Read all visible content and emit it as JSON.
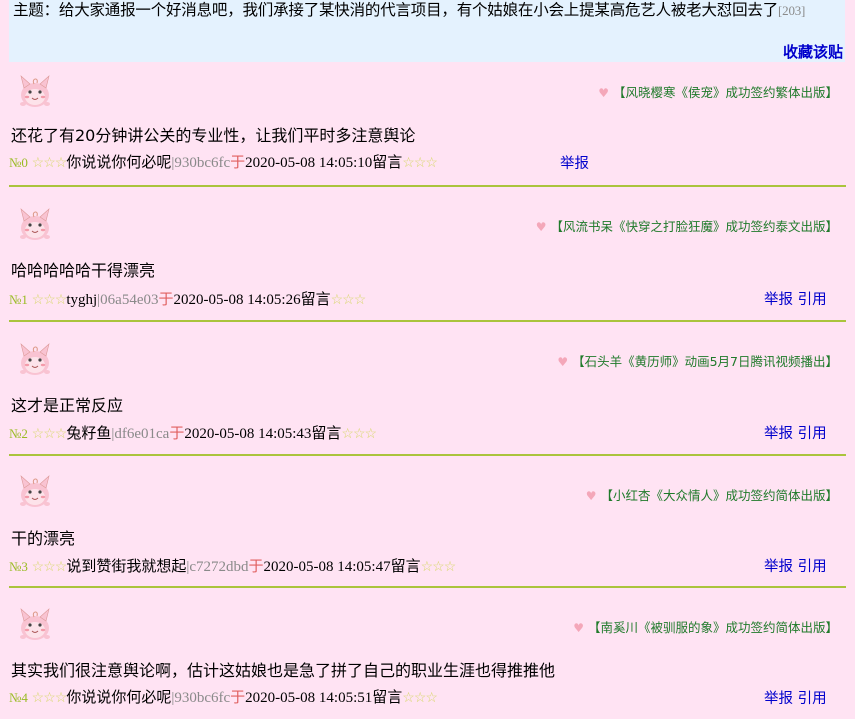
{
  "topic": {
    "text": "主题：给大家通报一个好消息吧，我们承接了某快消的代言项目，有个姑娘在小会上提某高危艺人被老大怼回去了",
    "count": "[203]",
    "favorite_label": "收藏该贴"
  },
  "posts": [
    {
      "ad": "【风晓樱寒《侯宠》成功签约繁体出版】",
      "content": "还花了有20分钟讲公关的专业性，让我们平时多注意舆论",
      "num": "№0",
      "stars_before": "☆☆☆",
      "author": "你说说你何必呢",
      "hash": "|930bc6fc",
      "yu": "于",
      "time": "2020-05-08 14:05:10",
      "liuyan": "留言",
      "stars_after": "☆☆☆",
      "report_label": "举报",
      "quote_label": ""
    },
    {
      "ad": "【风流书呆《快穿之打脸狂魔》成功签约泰文出版】",
      "content": "哈哈哈哈哈干得漂亮",
      "num": "№1",
      "stars_before": "☆☆☆",
      "author": "tyghj",
      "hash": "|06a54e03",
      "yu": "于",
      "time": "2020-05-08 14:05:26",
      "liuyan": "留言",
      "stars_after": "☆☆☆",
      "report_label": "举报",
      "quote_label": "引用"
    },
    {
      "ad": "【石头羊《黄历师》动画5月7日腾讯视频播出】",
      "content": "这才是正常反应",
      "num": "№2",
      "stars_before": "☆☆☆",
      "author": "兔籽鱼",
      "hash": "|df6e01ca",
      "yu": "于",
      "time": "2020-05-08 14:05:43",
      "liuyan": "留言",
      "stars_after": "☆☆☆",
      "report_label": "举报",
      "quote_label": "引用"
    },
    {
      "ad": "【小红杏《大众情人》成功签约简体出版】",
      "content": "干的漂亮",
      "num": "№3",
      "stars_before": "☆☆☆",
      "author": "说到赞街我就想起",
      "hash": "|c7272dbd",
      "yu": "于",
      "time": "2020-05-08 14:05:47",
      "liuyan": "留言",
      "stars_after": "☆☆☆",
      "report_label": "举报",
      "quote_label": "引用"
    },
    {
      "ad": "【南奚川《被驯服的象》成功签约简体出版】",
      "content": "其实我们很注意舆论啊，估计这姑娘也是急了拼了自己的职业生涯也得推推他",
      "num": "№4",
      "stars_before": "☆☆☆",
      "author": "你说说你何必呢",
      "hash": "|930bc6fc",
      "yu": "于",
      "time": "2020-05-08 14:05:51",
      "liuyan": "留言",
      "stars_after": "☆☆☆",
      "report_label": "举报",
      "quote_label": "引用"
    }
  ],
  "colors": {
    "page_bg": "#ffe3f3",
    "topic_bg": "#e4f2fe",
    "link": "#0000cc",
    "divider": "#aac43c",
    "ad_text": "#1f7a2a"
  }
}
